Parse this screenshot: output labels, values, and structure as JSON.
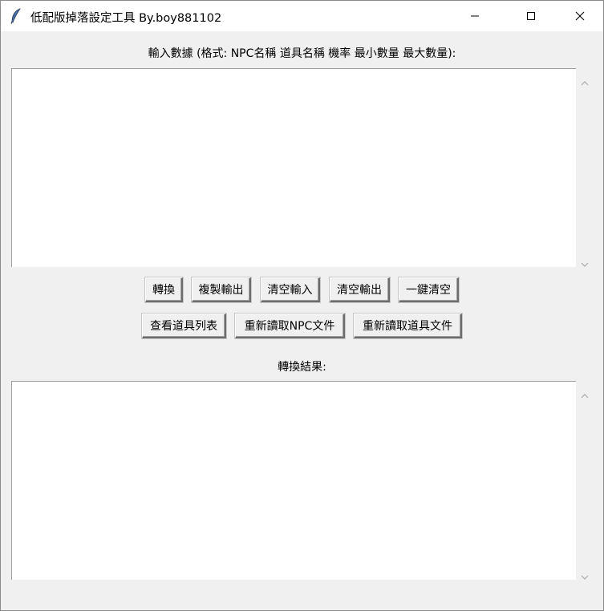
{
  "window": {
    "title": "低配版掉落設定工具 By.boy881102"
  },
  "input_section": {
    "label": "輸入數據 (格式: NPC名稱 道具名稱 機率 最小數量 最大數量):",
    "value": ""
  },
  "buttons_row1": {
    "convert": "轉換",
    "copy_output": "複製輸出",
    "clear_input": "清空輸入",
    "clear_output": "清空輸出",
    "clear_all": "一鍵清空"
  },
  "buttons_row2": {
    "view_items": "查看道具列表",
    "reload_npc": "重新讀取NPC文件",
    "reload_items": "重新讀取道具文件"
  },
  "output_section": {
    "label": "轉換結果:",
    "value": ""
  },
  "icons": {
    "app": "feather-icon",
    "minimize": "minimize-icon",
    "maximize": "maximize-icon",
    "close": "close-icon"
  }
}
